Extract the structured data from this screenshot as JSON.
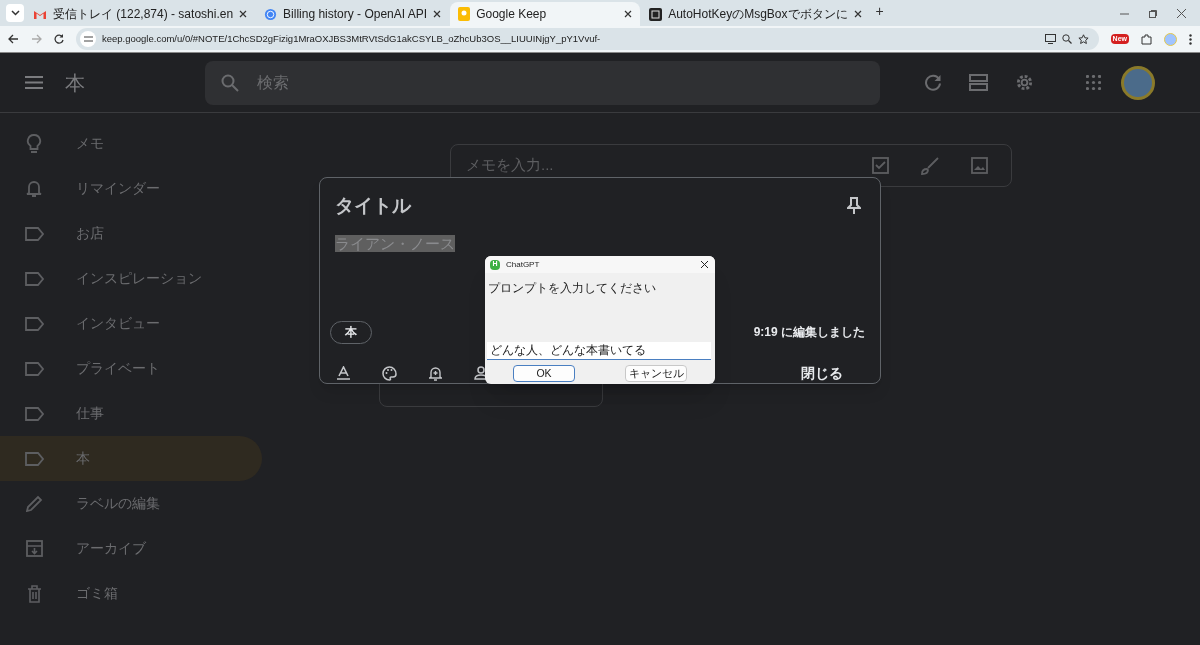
{
  "browser": {
    "tabs": [
      {
        "kind": "gmail",
        "title": "受信トレイ (122,874) - satoshi.en",
        "selected": false
      },
      {
        "kind": "globe",
        "title": "Billing history - OpenAI API",
        "selected": false
      },
      {
        "kind": "keep",
        "title": "Google Keep",
        "selected": true
      },
      {
        "kind": "ahk",
        "title": "AutoHotKeyのMsgBoxでボタンに",
        "selected": false
      }
    ],
    "new_tab": "+",
    "url": "keep.google.com/u/0/#NOTE/1ChcSD2gFizig1MraOXJBS3MtRVtSdG1akCSYLB_oZhcUb3OS__LIUUINjgY_pY1Vvuf-",
    "extension_badge": "New"
  },
  "app": {
    "title": "本",
    "search": {
      "placeholder": "検索"
    },
    "sidebar": [
      {
        "kind": "bulb",
        "label": "メモ",
        "selected": false
      },
      {
        "kind": "bell",
        "label": "リマインダー",
        "selected": false
      },
      {
        "kind": "label",
        "label": "お店",
        "selected": false
      },
      {
        "kind": "label",
        "label": "インスピレーション",
        "selected": false
      },
      {
        "kind": "label",
        "label": "インタビュー",
        "selected": false
      },
      {
        "kind": "label",
        "label": "プライベート",
        "selected": false
      },
      {
        "kind": "label",
        "label": "仕事",
        "selected": false
      },
      {
        "kind": "label",
        "label": "本",
        "selected": true
      },
      {
        "kind": "pencil",
        "label": "ラベルの編集",
        "selected": false
      },
      {
        "kind": "archive",
        "label": "アーカイブ",
        "selected": false
      },
      {
        "kind": "trash",
        "label": "ゴミ箱",
        "selected": false
      }
    ],
    "take_note": {
      "placeholder": "メモを入力..."
    },
    "note": {
      "title": "タイトル",
      "body": "ライアン・ノース",
      "label_chip": "本",
      "edited": "9:19 に編集しました",
      "close": "閉じる"
    }
  },
  "dialog": {
    "title": "ChatGPT",
    "icon_letter": "H",
    "prompt": "プロンプトを入力してください",
    "value": "どんな人、どんな本書いてる",
    "buttons": [
      {
        "label": "OK",
        "default": true
      },
      {
        "label": "キャンセル",
        "default": false
      }
    ]
  }
}
